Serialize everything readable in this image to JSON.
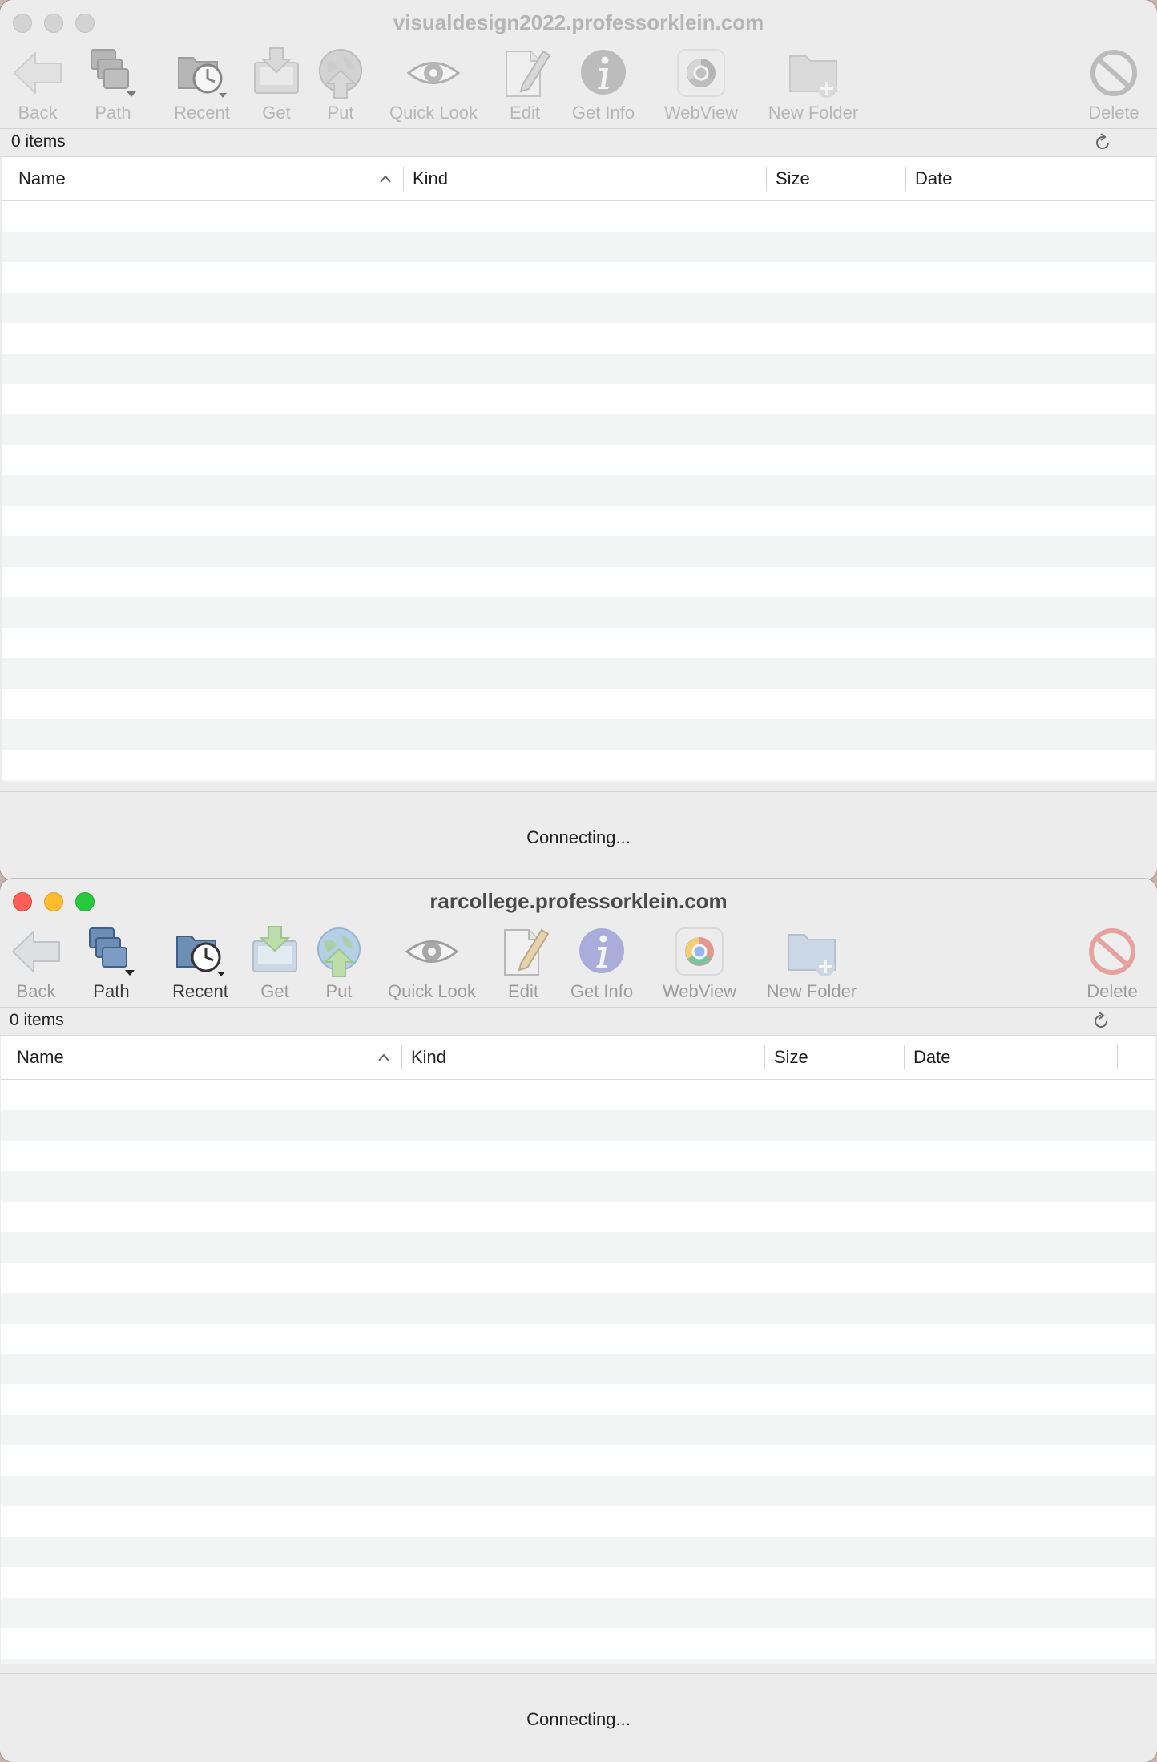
{
  "windows": [
    {
      "title": "visualdesign2022.professorklein.com",
      "state": "inactive",
      "item_count": "0 items",
      "status": "Connecting...",
      "toolbar": {
        "back": "Back",
        "path": "Path",
        "recent": "Recent",
        "get": "Get",
        "put": "Put",
        "quick_look": "Quick Look",
        "edit": "Edit",
        "get_info": "Get Info",
        "webview": "WebView",
        "new_folder": "New Folder",
        "delete": "Delete"
      },
      "columns": {
        "name": "Name",
        "kind": "Kind",
        "size": "Size",
        "date": "Date"
      }
    },
    {
      "title": "rarcollege.professorklein.com",
      "state": "active",
      "item_count": "0 items",
      "status": "Connecting...",
      "toolbar": {
        "back": "Back",
        "path": "Path",
        "recent": "Recent",
        "get": "Get",
        "put": "Put",
        "quick_look": "Quick Look",
        "edit": "Edit",
        "get_info": "Get Info",
        "webview": "WebView",
        "new_folder": "New Folder",
        "delete": "Delete"
      },
      "columns": {
        "name": "Name",
        "kind": "Kind",
        "size": "Size",
        "date": "Date"
      }
    }
  ],
  "icons": {
    "back": "back-arrow-icon",
    "path": "path-stack-icon",
    "recent": "recent-clock-icon",
    "get": "download-tray-icon",
    "put": "upload-globe-icon",
    "quick_look": "eye-icon",
    "edit": "edit-pencil-icon",
    "get_info": "info-icon",
    "webview": "browser-icon",
    "new_folder": "new-folder-icon",
    "delete": "delete-prohibited-icon",
    "refresh": "refresh-icon",
    "sort": "sort-ascending-icon"
  }
}
